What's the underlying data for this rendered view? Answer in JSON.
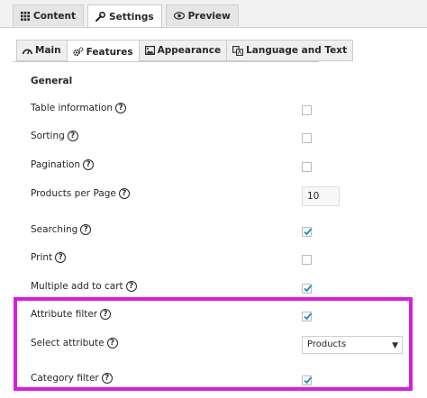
{
  "top_tabs": [
    {
      "label": "Content",
      "icon": "grid-icon"
    },
    {
      "label": "Settings",
      "icon": "wrench-icon",
      "active": true
    },
    {
      "label": "Preview",
      "icon": "eye-icon"
    }
  ],
  "sub_tabs": [
    {
      "label": "Main",
      "icon": "dashboard-icon"
    },
    {
      "label": "Features",
      "icon": "cogs-icon",
      "active": true
    },
    {
      "label": "Appearance",
      "icon": "image-icon"
    },
    {
      "label": "Language and Text",
      "icon": "translate-icon"
    }
  ],
  "section_title": "General",
  "rows": {
    "table_information": {
      "label": "Table information",
      "checked": false
    },
    "sorting": {
      "label": "Sorting",
      "checked": false
    },
    "pagination": {
      "label": "Pagination",
      "checked": false
    },
    "products_per_page": {
      "label": "Products per Page",
      "value": "10"
    },
    "searching": {
      "label": "Searching",
      "checked": true
    },
    "print": {
      "label": "Print",
      "checked": false
    },
    "multiple_add_to_cart": {
      "label": "Multiple add to cart",
      "checked": true
    },
    "attribute_filter": {
      "label": "Attribute filter",
      "checked": true
    },
    "select_attribute": {
      "label": "Select attribute",
      "value": "Products"
    },
    "category_filter": {
      "label": "Category filter",
      "checked": true
    }
  },
  "help_glyph": "?",
  "colors": {
    "highlight": "#d91ed9",
    "check": "#1e8cbe"
  }
}
